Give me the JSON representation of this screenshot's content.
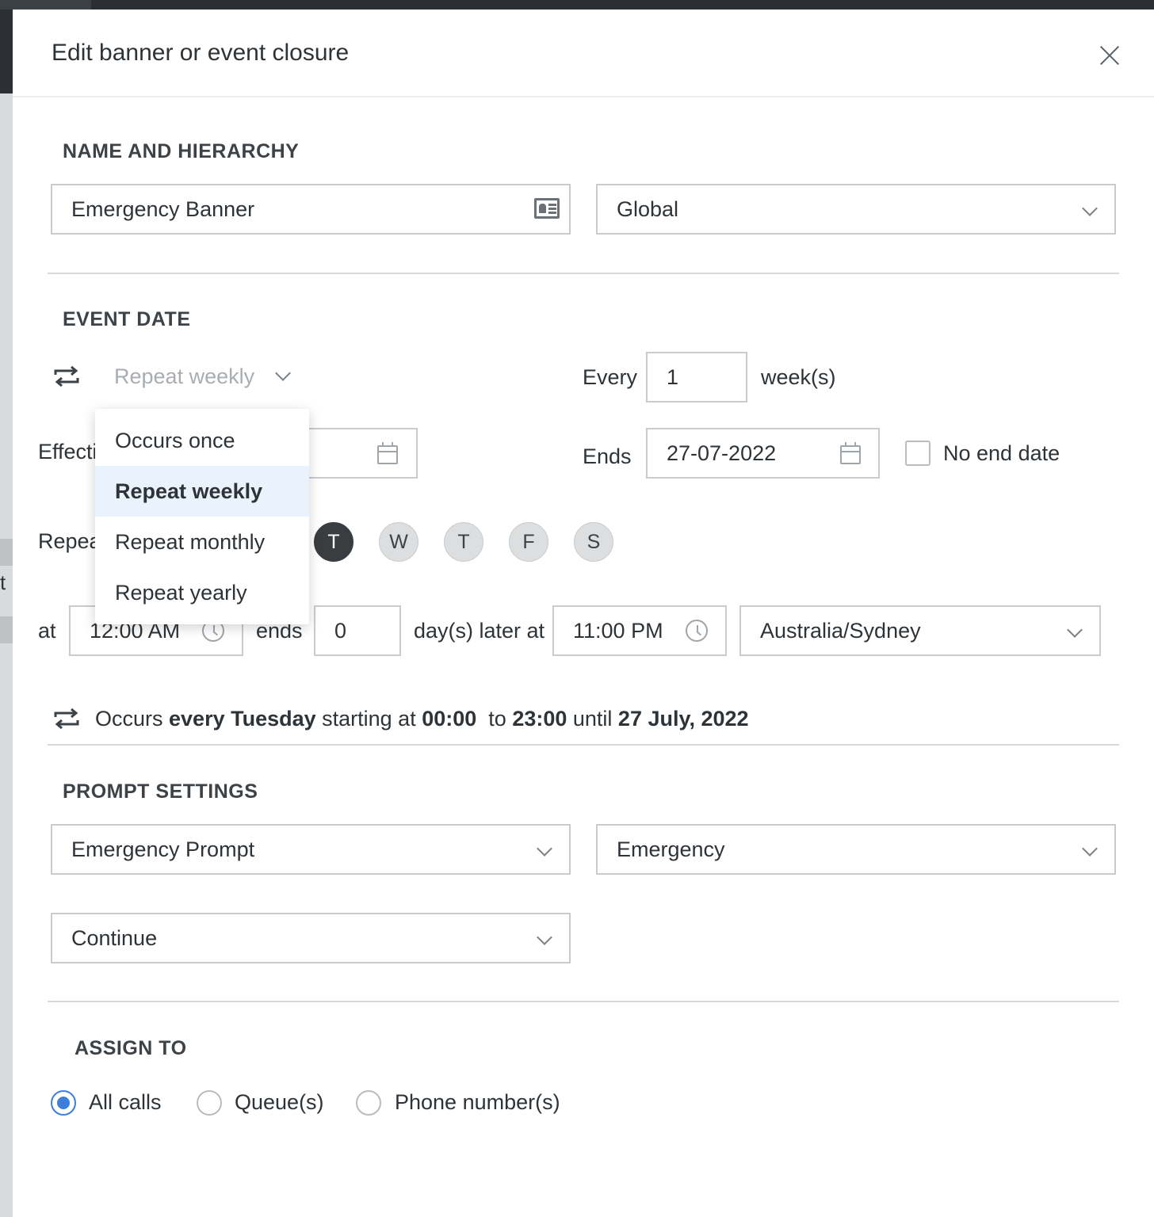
{
  "modal": {
    "title": "Edit banner or event closure"
  },
  "name_hierarchy": {
    "section_title": "NAME AND HIERARCHY",
    "name_value": "Emergency Banner",
    "hierarchy_value": "Global"
  },
  "event_date": {
    "section_title": "EVENT DATE",
    "repeat_select": "Repeat weekly",
    "every_label": "Every",
    "every_value": "1",
    "every_unit": "week(s)",
    "effective_label_partial": "Effecti",
    "ends_label": "Ends",
    "ends_value": "27-07-2022",
    "no_end_date_label": "No end date",
    "repeat_label_partial": "Repea",
    "days": [
      {
        "label": "T",
        "active": true
      },
      {
        "label": "W",
        "active": false
      },
      {
        "label": "T",
        "active": false
      },
      {
        "label": "F",
        "active": false
      },
      {
        "label": "S",
        "active": false
      }
    ],
    "at_label": "at",
    "start_time": "12:00 AM",
    "ends_small_label": "ends",
    "days_later_value": "0",
    "days_later_label": "day(s) later at",
    "end_time": "11:00 PM",
    "timezone": "Australia/Sydney",
    "dropdown_options": [
      "Occurs once",
      "Repeat weekly",
      "Repeat monthly",
      "Repeat yearly"
    ],
    "dropdown_selected": "Repeat weekly",
    "summary": {
      "t1": "Occurs ",
      "b1": "every Tuesday",
      "t2": " starting at ",
      "b2": "00:00",
      "t3": "  to ",
      "b3": "23:00",
      "t4": " until ",
      "b4": "27 July, 2022"
    }
  },
  "prompt_settings": {
    "section_title": "PROMPT SETTINGS",
    "prompt_value": "Emergency Prompt",
    "category_value": "Emergency",
    "action_value": "Continue"
  },
  "assign_to": {
    "section_title": "ASSIGN TO",
    "options": [
      "All calls",
      "Queue(s)",
      "Phone number(s)"
    ],
    "selected": "All calls"
  },
  "background": {
    "partial_text": "t"
  },
  "colors": {
    "accent": "#3f7fdc",
    "selected_option_bg": "#eaf3fb",
    "active_day": "#3a3d40"
  }
}
